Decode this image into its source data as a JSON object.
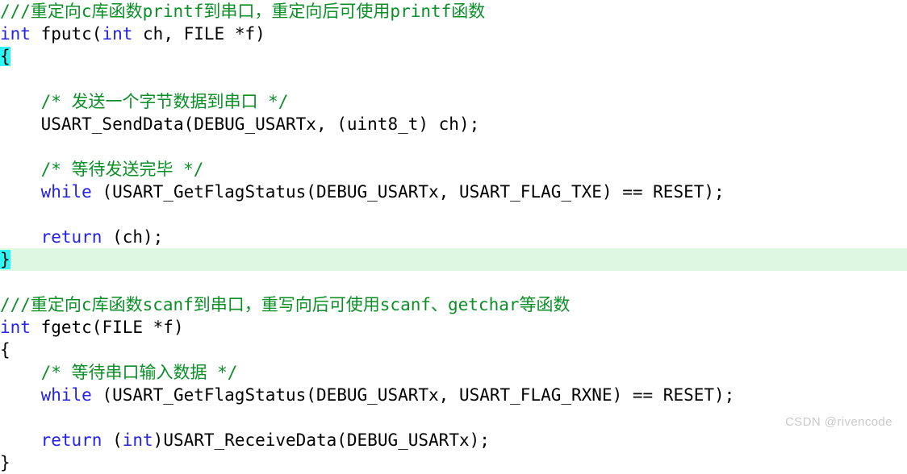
{
  "editor": {
    "background_color": "#ffffff",
    "comment_color": "#0a8f27",
    "keyword_color": "#2222e8",
    "plain_color": "#000000",
    "brace_highlight_color": "#2ff6f6",
    "line_band_color": "#ddf7e3"
  },
  "lines": [
    {
      "id": "line-1",
      "kind": "comment",
      "indent": "",
      "text": "///重定向c库函数printf到串口，重定向后可使用printf函数"
    },
    {
      "id": "line-2",
      "kind": "code",
      "indent": "",
      "keyword": "int",
      "rest": " fputc(",
      "keyword2": "int",
      "rest2": " ch, FILE *f)"
    },
    {
      "id": "line-3",
      "kind": "brace-open-highlight",
      "indent": "",
      "text": "{"
    },
    {
      "id": "line-4",
      "kind": "blank",
      "text": ""
    },
    {
      "id": "line-5",
      "kind": "comment",
      "indent": "    ",
      "text": "/* 发送一个字节数据到串口 */"
    },
    {
      "id": "line-6",
      "kind": "plain",
      "indent": "    ",
      "text": "USART_SendData(DEBUG_USARTx, (uint8_t) ch);"
    },
    {
      "id": "line-7",
      "kind": "blank",
      "text": ""
    },
    {
      "id": "line-8",
      "kind": "comment",
      "indent": "    ",
      "text": "/* 等待发送完毕 */"
    },
    {
      "id": "line-9",
      "kind": "code",
      "indent": "    ",
      "keyword": "while",
      "rest": " (USART_GetFlagStatus(DEBUG_USARTx, USART_FLAG_TXE) == RESET);",
      "keyword2": "",
      "rest2": ""
    },
    {
      "id": "line-10",
      "kind": "blank",
      "text": ""
    },
    {
      "id": "line-11",
      "kind": "code",
      "indent": "    ",
      "keyword": "return",
      "rest": " (ch);",
      "keyword2": "",
      "rest2": ""
    },
    {
      "id": "line-12",
      "kind": "brace-close-highlight",
      "indent": "",
      "text": "}"
    },
    {
      "id": "line-13",
      "kind": "blank",
      "text": ""
    },
    {
      "id": "line-14",
      "kind": "comment",
      "indent": "",
      "text": "///重定向c库函数scanf到串口，重写向后可使用scanf、getchar等函数"
    },
    {
      "id": "line-15",
      "kind": "code",
      "indent": "",
      "keyword": "int",
      "rest": " fgetc(FILE *f)",
      "keyword2": "",
      "rest2": ""
    },
    {
      "id": "line-16",
      "kind": "plain",
      "indent": "",
      "text": "{"
    },
    {
      "id": "line-17",
      "kind": "comment",
      "indent": "    ",
      "text": "/* 等待串口输入数据 */"
    },
    {
      "id": "line-18",
      "kind": "code",
      "indent": "    ",
      "keyword": "while",
      "rest": " (USART_GetFlagStatus(DEBUG_USARTx, USART_FLAG_RXNE) == RESET);",
      "keyword2": "",
      "rest2": ""
    },
    {
      "id": "line-19",
      "kind": "blank",
      "text": ""
    },
    {
      "id": "line-20",
      "kind": "code",
      "indent": "    ",
      "keyword": "return",
      "rest": " (",
      "keyword2": "int",
      "rest2": ")USART_ReceiveData(DEBUG_USARTx);"
    },
    {
      "id": "line-21",
      "kind": "plain",
      "indent": "",
      "text": "}"
    }
  ],
  "watermark": {
    "text": "CSDN @rivencode"
  }
}
